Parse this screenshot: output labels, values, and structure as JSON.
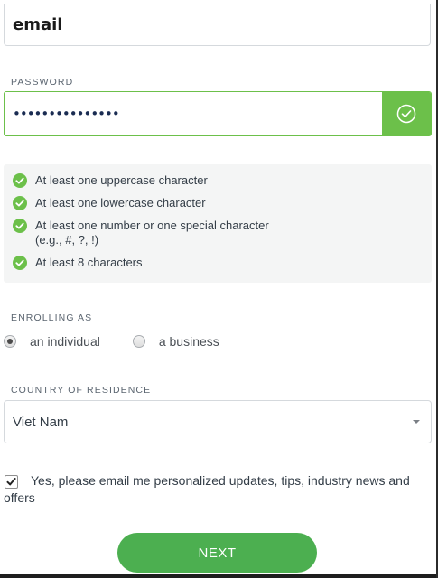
{
  "email": {
    "value": "email"
  },
  "password": {
    "label": "PASSWORD",
    "value": "•••••••••••••••",
    "valid_icon": "check-circle-icon",
    "valid_color": "#6cc04a"
  },
  "requirements": [
    {
      "text": "At least one uppercase character",
      "sub": ""
    },
    {
      "text": "At least one lowercase character",
      "sub": ""
    },
    {
      "text": "At least one number or one special character",
      "sub": "(e.g., #, ?, !)"
    },
    {
      "text": "At least 8 characters",
      "sub": ""
    }
  ],
  "enrolling": {
    "label": "ENROLLING AS",
    "options": [
      {
        "label": "an individual",
        "selected": true
      },
      {
        "label": "a business",
        "selected": false
      }
    ]
  },
  "country": {
    "label": "COUNTRY OF RESIDENCE",
    "value": "Viet Nam"
  },
  "consent": {
    "text": "Yes, please email me personalized updates, tips, industry news and offers",
    "checked": true
  },
  "next_button": {
    "label": "NEXT",
    "color": "#4caf50"
  }
}
